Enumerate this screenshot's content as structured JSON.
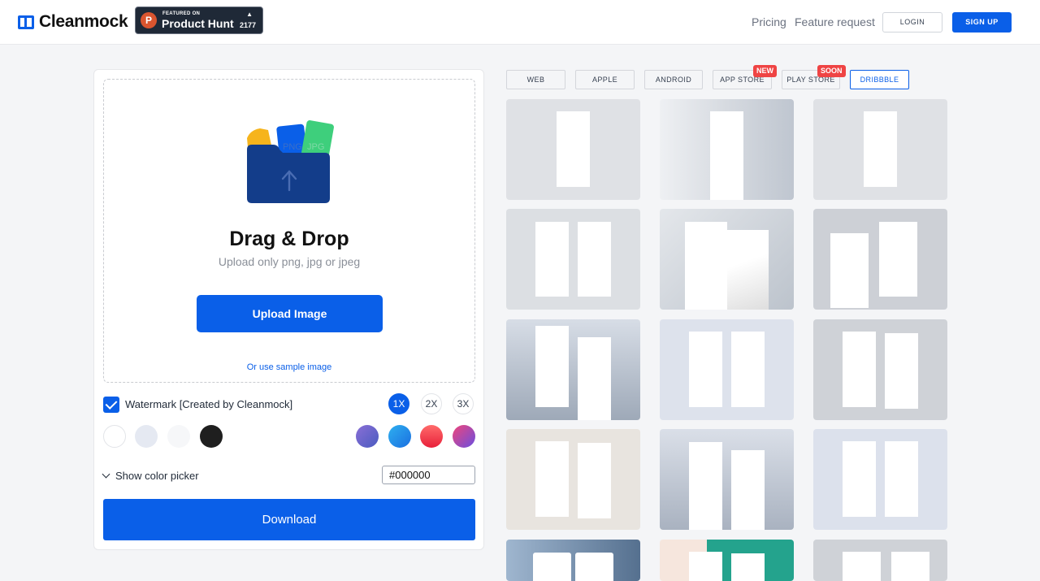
{
  "header": {
    "brand": "Cleanmock",
    "product_hunt": {
      "featured": "FEATURED ON",
      "name": "Product Hunt",
      "arrow": "▲",
      "count": "2177",
      "logo_letter": "P"
    },
    "nav": {
      "pricing": "Pricing",
      "feature_request": "Feature request",
      "login": "LOGIN",
      "signup": "SIGN UP"
    }
  },
  "upload": {
    "title": "Drag & Drop",
    "subtitle": "Upload only png, jpg or jpeg",
    "button": "Upload Image",
    "sample_link": "Or use sample image",
    "file_labels": {
      "png": "PNG",
      "jpg": "JPG"
    }
  },
  "options": {
    "watermark_label": "Watermark [Created by Cleanmock]",
    "watermark_checked": true,
    "scales": [
      "1X",
      "2X",
      "3X"
    ],
    "active_scale": "1X",
    "colors": [
      "#ffffff",
      "#e5e9f2",
      "#f6f7f9",
      "#1f1f1f"
    ],
    "gradients": [
      "#6d5bc4",
      "#1b8fe6",
      "#ee3344",
      "#9b4dd6"
    ],
    "color_picker_label": "Show color picker",
    "hex_value": "#000000",
    "download": "Download"
  },
  "tabs": {
    "items": [
      "WEB",
      "APPLE",
      "ANDROID",
      "APP STORE",
      "PLAY STORE",
      "DRIBBBLE"
    ],
    "active": "DRIBBBLE",
    "badge_new": "NEW",
    "badge_soon": "SOON"
  },
  "accent_color": "#0a5fe8"
}
